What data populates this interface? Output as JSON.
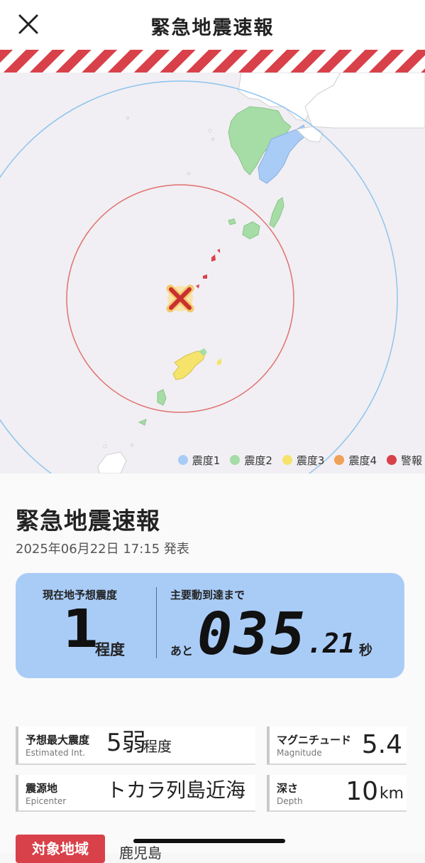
{
  "header": {
    "title": "緊急地震速報",
    "close_icon": "close-icon"
  },
  "map": {
    "legend": [
      {
        "label": "震度1",
        "color": "#a9ccf7"
      },
      {
        "label": "震度2",
        "color": "#a6dca6"
      },
      {
        "label": "震度3",
        "color": "#f5e36b"
      },
      {
        "label": "震度4",
        "color": "#f0a058"
      },
      {
        "label": "警報",
        "color": "#d9414a"
      }
    ],
    "epicenter_icon": "epicenter-x-icon"
  },
  "info": {
    "title": "緊急地震速報",
    "issued": "2025年06月22日 17:15 発表"
  },
  "eta": {
    "local_label": "現在地予想震度",
    "local_value": "1",
    "local_unit": "程度",
    "arrival_label": "主要動到達まで",
    "prefix": "あと",
    "seconds": "035",
    "fraction": ".21",
    "unit": "秒"
  },
  "facts": {
    "max_int": {
      "label": "予想最大震度",
      "sub": "Estimated Int.",
      "value": "5弱",
      "suffix": "程度"
    },
    "magnitude": {
      "label": "マグニチュード",
      "sub": "Magnitude",
      "value": "5.4"
    },
    "epicenter": {
      "label": "震源地",
      "sub": "Epicenter",
      "value": "トカラ列島近海"
    },
    "depth": {
      "label": "深さ",
      "sub": "Depth",
      "value": "10",
      "unit": "km"
    }
  },
  "target": {
    "button": "対象地域",
    "region": "鹿児島"
  }
}
